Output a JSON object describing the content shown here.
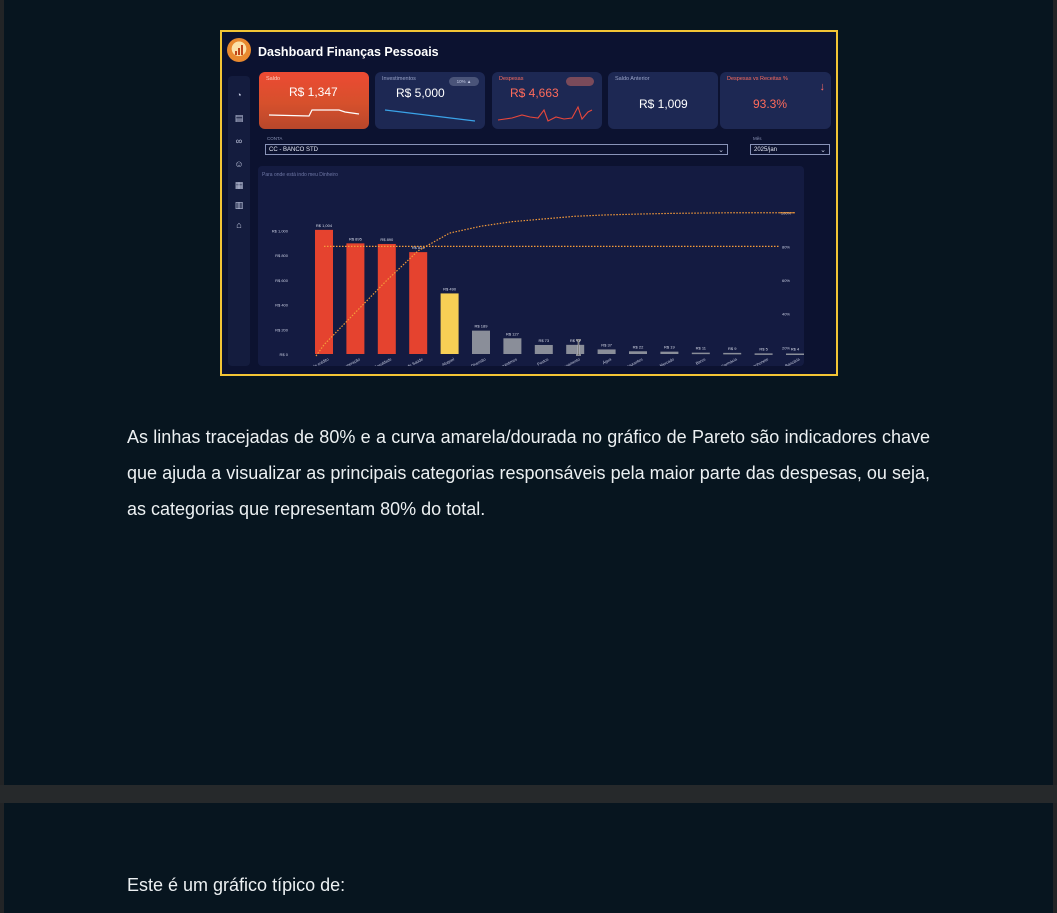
{
  "dashboard": {
    "title": "Dashboard Finanças Pessoais",
    "sidebar_icons": [
      "pie-chart-icon",
      "document-icon",
      "link-icon",
      "people-icon",
      "calculator-icon",
      "bar-chart-icon",
      "bank-icon"
    ],
    "cards": {
      "saldo": {
        "label": "Saldo",
        "value": "R$ 1,347"
      },
      "investimentos": {
        "label": "Investimentos",
        "value": "R$ 5,000",
        "badge": "10% ▲"
      },
      "despesas": {
        "label": "Despesas",
        "value": "R$ 4,663",
        "badge": ""
      },
      "saldo_anterior": {
        "label": "Saldo Anterior",
        "value": "R$ 1,009"
      },
      "despesas_vs_receitas": {
        "label": "Despesas vs Receitas %",
        "value": "93.3%"
      }
    },
    "filters": {
      "conta_label": "CONTA",
      "conta_value": "CC - BANCO STD",
      "mes_label": "Mês",
      "mes_value": "2025/jan"
    },
    "colors": {
      "accent": "#f3c535",
      "red_bar": "#e5432f",
      "yellow_bar": "#f7cf55",
      "gray_bar": "#8a8e99",
      "pareto_line": "#f59b3a"
    }
  },
  "chart_data": {
    "type": "bar",
    "title": "Para onde está indo meu Dinheiro",
    "categories": [
      "Cartão de crédito",
      "Remuneração",
      "Faculdade",
      "Plano de Saúde",
      "Aluguel",
      "Diversão",
      "Empréstimos",
      "Postos",
      "Estacionamento",
      "Água",
      "Restaurantes",
      "Mercado",
      "Bares",
      "Farmácia",
      "Lanchonete",
      "Cesta Bancária"
    ],
    "values": [
      1004,
      895,
      890,
      824,
      490,
      189,
      127,
      73,
      74,
      37,
      22,
      19,
      11,
      9,
      5,
      4
    ],
    "data_labels": [
      "R$ 1,004",
      "R$ 895",
      "R$ 890",
      "R$ 824",
      "R$ 490",
      "R$ 189",
      "R$ 127",
      "R$ 73",
      "R$ 74",
      "R$ 37",
      "R$ 22",
      "R$ 19",
      "R$ 11",
      "R$ 9",
      "R$ 5",
      "R$ 4"
    ],
    "bar_colors": [
      "red",
      "red",
      "red",
      "red",
      "yellow",
      "gray",
      "gray",
      "gray",
      "gray",
      "gray",
      "gray",
      "gray",
      "gray",
      "gray",
      "gray",
      "gray"
    ],
    "y_ticks": [
      "R$ 0",
      "R$ 200",
      "R$ 400",
      "R$ 600",
      "R$ 800",
      "R$ 1,000"
    ],
    "y_tick_values": [
      0,
      200,
      400,
      600,
      800,
      1000
    ],
    "ylim": [
      0,
      1100
    ],
    "y2_ticks": [
      "20%",
      "40%",
      "60%",
      "80%",
      "100%"
    ],
    "y2_tick_values": [
      20,
      40,
      60,
      80,
      100
    ],
    "y2lim": [
      16,
      104
    ],
    "cumulative_percent": [
      21.5,
      40.7,
      59.8,
      77.4,
      87.9,
      92.0,
      94.7,
      96.3,
      97.9,
      98.7,
      99.2,
      99.6,
      99.8,
      100.0,
      100.0,
      100.0
    ],
    "threshold_percent": 80
  },
  "text": {
    "paragraph": "As linhas tracejadas de 80% e a curva amarela/dourada no gráfico de Pareto são indicadores chave que ajuda a visualizar as principais categorias responsáveis pela maior parte das despesas, ou seja, as categorias que representam 80% do total.",
    "question": "Este é um gráfico típico de:"
  }
}
